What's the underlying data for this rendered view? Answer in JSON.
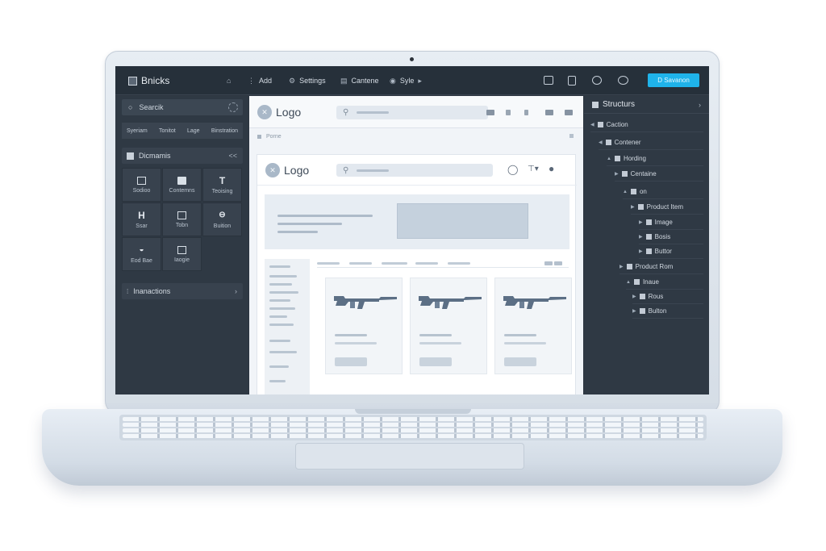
{
  "app": {
    "brand": "Bnicks",
    "menu": {
      "add": "Add",
      "settings": "Settings",
      "content": "Cantene",
      "style": "Syle"
    },
    "save_label": "D Savanon"
  },
  "left_panel": {
    "search_label": "Searcik",
    "categories": [
      "Syeriam",
      "Tonitot",
      "Lage",
      "Binstration"
    ],
    "elements_header": "Dicmamis",
    "elements_chevron": "<<",
    "tiles": [
      {
        "label": "Sodioo",
        "glyph": "box"
      },
      {
        "label": "Contemns",
        "glyph": "fill"
      },
      {
        "label": "Teoising",
        "glyph": "T"
      },
      {
        "label": "Ssar",
        "glyph": "H"
      },
      {
        "label": "Tobn",
        "glyph": "box"
      },
      {
        "label": "Buition",
        "glyph": "link"
      },
      {
        "label": "Eod Bae",
        "glyph": "half"
      },
      {
        "label": "Iaogie",
        "glyph": "box"
      }
    ],
    "interactions_header": "Inanactions",
    "interactions_chevron": "›"
  },
  "canvas": {
    "logo_text": "Logo",
    "breadcrumb": "Porne",
    "inner_logo_text": "Logo"
  },
  "structure": {
    "title": "Structurs",
    "chevron": "›",
    "nodes": [
      {
        "label": "Caction"
      },
      {
        "label": "Contener"
      },
      {
        "label": "Hording"
      },
      {
        "label": "Centaine"
      },
      {
        "label": "on"
      },
      {
        "label": "Product Item"
      },
      {
        "label": "Image"
      },
      {
        "label": "Bosis"
      },
      {
        "label": "Buttor"
      },
      {
        "label": "Product Rom"
      },
      {
        "label": "Inaue"
      },
      {
        "label": "Rous"
      },
      {
        "label": "Bulton"
      }
    ]
  },
  "colors": {
    "accent": "#1fb3ea",
    "panel": "#2f3944",
    "topbar": "#26303a",
    "canvas": "#f1f4f8"
  }
}
